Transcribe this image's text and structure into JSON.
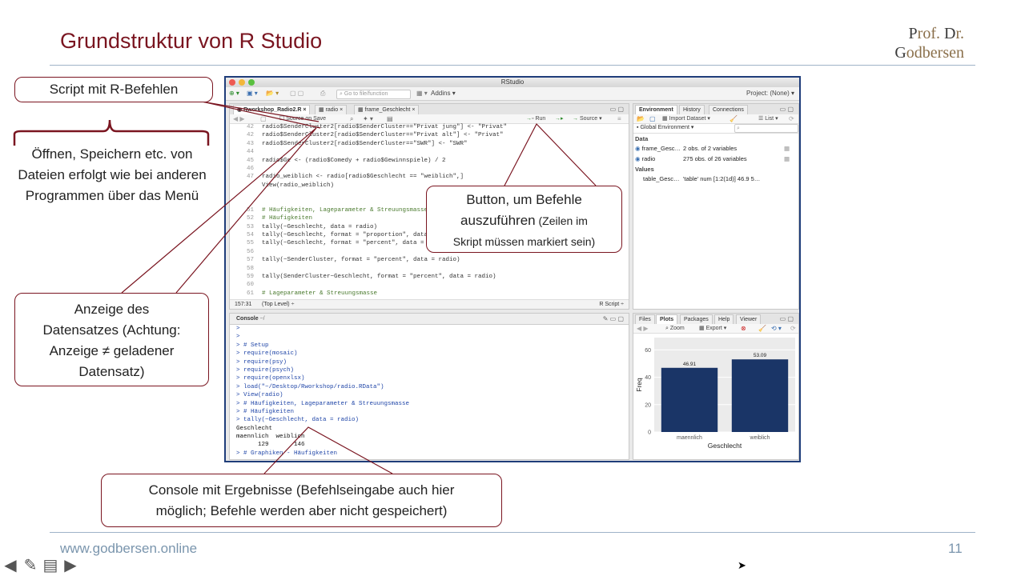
{
  "slide": {
    "title": "Grundstruktur von R Studio",
    "logo_line1_a": "P",
    "logo_line1_b": "rof. ",
    "logo_line1_c": "D",
    "logo_line1_d": "r.",
    "logo_line2_a": "G",
    "logo_line2_b": "odbersen",
    "footer_url": "www.godbersen.online",
    "page_number": "11"
  },
  "callouts": {
    "script": "Script mit R-Befehlen",
    "menu": "Öffnen, Speichern etc. von Dateien erfolgt wie bei anderen Programmen über das Menü",
    "dataset_1": "Anzeige des",
    "dataset_2": "Datensatzes (Achtung:",
    "dataset_3": "Anzeige ≠ geladener",
    "dataset_4": "Datensatz)",
    "run_1": "Button, um Befehle",
    "run_2a": "auszuführen",
    "run_2b": " (Zeilen im",
    "run_3": "Skript müssen markiert sein)",
    "console_1": "Console mit Ergebnisse (Befehlseingabe auch hier",
    "console_2": "möglich; Befehle werden aber nicht gespeichert)"
  },
  "rstudio": {
    "window_title": "RStudio",
    "toolbar": {
      "goto": "Go to file/function",
      "addins": "Addins",
      "project": "Project: (None)"
    },
    "editor": {
      "tabs": [
        "Rworkshop_Radio2.R",
        "radio",
        "frame_Geschlecht"
      ],
      "source_on_save": "Source on Save",
      "run": "Run",
      "source": "Source",
      "lines": [
        {
          "n": "42",
          "t": "radio$SenderCluster2[radio$SenderCluster==\"Privat jung\"] <- \"Privat\""
        },
        {
          "n": "42",
          "t": "radio$SenderCluster2[radio$SenderCluster==\"Privat alt\"] <- \"Privat\""
        },
        {
          "n": "43",
          "t": "radio$SenderCluster2[radio$SenderCluster==\"SWR\"] <- \"SWR\""
        },
        {
          "n": "44",
          "t": ""
        },
        {
          "n": "45",
          "t": "radio$Ge <- (radio$Comedy + radio$Gewinnspiele) / 2"
        },
        {
          "n": "46",
          "t": ""
        },
        {
          "n": "47",
          "t": "radio_weiblich <- radio[radio$Geschlecht == \"weiblich\",]"
        },
        {
          "n": "",
          "t": "View(radio_weiblich)"
        },
        {
          "n": "",
          "t": ""
        },
        {
          "n": "",
          "t": ""
        },
        {
          "n": "51",
          "t": "# Häufigkeiten, Lageparameter & Streuungsmasse"
        },
        {
          "n": "52",
          "t": "# Häufigkeiten"
        },
        {
          "n": "53",
          "t": "tally(~Geschlecht, data = radio)"
        },
        {
          "n": "54",
          "t": "tally(~Geschlecht, format = \"proportion\", data = radio)"
        },
        {
          "n": "55",
          "t": "tally(~Geschlecht, format = \"percent\", data = radio)"
        },
        {
          "n": "56",
          "t": ""
        },
        {
          "n": "57",
          "t": "tally(~SenderCluster, format = \"percent\", data = radio)"
        },
        {
          "n": "58",
          "t": ""
        },
        {
          "n": "59",
          "t": "tally(SenderCluster~Geschlecht, format = \"percent\", data = radio)"
        },
        {
          "n": "60",
          "t": ""
        },
        {
          "n": "61",
          "t": "# Lageparameter & Streuungsmasse"
        }
      ],
      "status_pos": "157:31",
      "status_level": "(Top Level) ÷",
      "status_type": "R Script ÷"
    },
    "console": {
      "tab": "Console",
      "path": "~/",
      "lines": [
        {
          "c": "prompt",
          "t": ">"
        },
        {
          "c": "prompt",
          "t": ">"
        },
        {
          "c": "prompt",
          "t": "> # Setup"
        },
        {
          "c": "prompt",
          "t": "> require(mosaic)"
        },
        {
          "c": "prompt",
          "t": "> require(psy)"
        },
        {
          "c": "prompt",
          "t": "> require(psych)"
        },
        {
          "c": "prompt",
          "t": "> require(openxlsx)"
        },
        {
          "c": "prompt",
          "t": "> load(\"~/Desktop/Rworkshop/radio.RData\")"
        },
        {
          "c": "prompt",
          "t": "> View(radio)"
        },
        {
          "c": "prompt",
          "t": "> # Häufigkeiten, Lageparameter & Streuungsmasse"
        },
        {
          "c": "prompt",
          "t": "> # Häufigkeiten"
        },
        {
          "c": "prompt",
          "t": "> tally(~Geschlecht, data = radio)"
        },
        {
          "c": "out",
          "t": "Geschlecht"
        },
        {
          "c": "out",
          "t": "maennlich  weiblich"
        },
        {
          "c": "out",
          "t": "      129       146"
        },
        {
          "c": "prompt",
          "t": "> # Graphiken - Häufigkeiten"
        }
      ]
    },
    "environment": {
      "tabs": [
        "Environment",
        "History",
        "Connections"
      ],
      "import": "Import Dataset",
      "list": "List",
      "scope": "Global Environment",
      "data_header": "Data",
      "values_header": "Values",
      "rows": [
        {
          "name": "frame_Gesc…",
          "value": "2 obs. of 2 variables"
        },
        {
          "name": "radio",
          "value": "275 obs. of 26 variables"
        }
      ],
      "value_rows": [
        {
          "name": "table_Gesc…",
          "value": "'table' num [1:2(1d)] 46.9 5…"
        }
      ]
    },
    "plots": {
      "tabs": [
        "Files",
        "Plots",
        "Packages",
        "Help",
        "Viewer"
      ],
      "zoom": "Zoom",
      "export": "Export"
    }
  },
  "chart_data": {
    "type": "bar",
    "categories": [
      "maennlich",
      "weiblich"
    ],
    "values": [
      46.91,
      53.09
    ],
    "data_labels": [
      "46.91",
      "53.09"
    ],
    "xlabel": "Geschlecht",
    "ylabel": "Freq",
    "ylim": [
      0,
      69
    ],
    "yticks": [
      0,
      20,
      40,
      60
    ],
    "bar_color": "#1a3567",
    "grid": true
  },
  "colors": {
    "accent": "#7a1520",
    "footer": "#7a95ad",
    "rule": "#9fb3c8",
    "window_border": "#1f3d7a"
  }
}
